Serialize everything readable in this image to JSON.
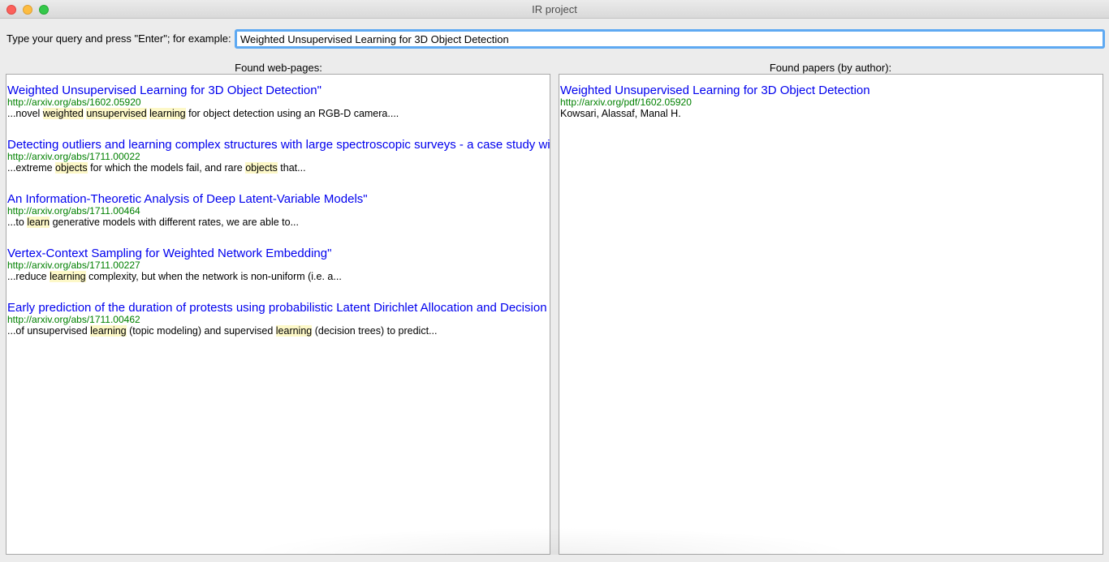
{
  "window": {
    "title": "IR project"
  },
  "query": {
    "label": "Type your query and press \"Enter\"; for example:",
    "value": "Weighted Unsupervised Learning for 3D Object Detection"
  },
  "webpages": {
    "header": "Found web-pages:",
    "results": [
      {
        "title": "Weighted Unsupervised Learning for 3D Object Detection\"",
        "url": "http://arxiv.org/abs/1602.05920",
        "snippet": [
          {
            "t": "...novel "
          },
          {
            "t": "weighted",
            "hl": true
          },
          {
            "t": " "
          },
          {
            "t": "unsupervised",
            "hl": true
          },
          {
            "t": " "
          },
          {
            "t": "learning",
            "hl": true
          },
          {
            "t": " for object detection using an RGB-D camera...."
          }
        ]
      },
      {
        "title": "Detecting outliers and learning complex structures with large spectroscopic surveys - a case study with APOGEE stars\"",
        "url": "http://arxiv.org/abs/1711.00022",
        "snippet": [
          {
            "t": "...extreme "
          },
          {
            "t": "objects",
            "hl": true
          },
          {
            "t": " for which the models fail, and rare "
          },
          {
            "t": "objects",
            "hl": true
          },
          {
            "t": " that..."
          }
        ]
      },
      {
        "title": "An Information-Theoretic Analysis of Deep Latent-Variable Models\"",
        "url": "http://arxiv.org/abs/1711.00464",
        "snippet": [
          {
            "t": "...to "
          },
          {
            "t": "learn",
            "hl": true
          },
          {
            "t": " generative models with different rates, we are able to..."
          }
        ]
      },
      {
        "title": "Vertex-Context Sampling for Weighted Network Embedding\"",
        "url": "http://arxiv.org/abs/1711.00227",
        "snippet": [
          {
            "t": "...reduce "
          },
          {
            "t": "learning",
            "hl": true
          },
          {
            "t": " complexity, but when the network is non-uniform (i.e. a..."
          }
        ]
      },
      {
        "title": "Early prediction of the duration of protests using probabilistic Latent Dirichlet Allocation and Decision Trees\"",
        "url": "http://arxiv.org/abs/1711.00462",
        "snippet": [
          {
            "t": "...of unsupervised "
          },
          {
            "t": "learning",
            "hl": true
          },
          {
            "t": " (topic modeling) and supervised "
          },
          {
            "t": "learning",
            "hl": true
          },
          {
            "t": " (decision trees) to predict..."
          }
        ]
      }
    ]
  },
  "papers": {
    "header": "Found papers (by author):",
    "results": [
      {
        "title": "Weighted Unsupervised Learning for 3D Object Detection",
        "url": "http://arxiv.org/pdf/1602.05920",
        "authors": "Kowsari, Alassaf, Manal H."
      }
    ]
  }
}
